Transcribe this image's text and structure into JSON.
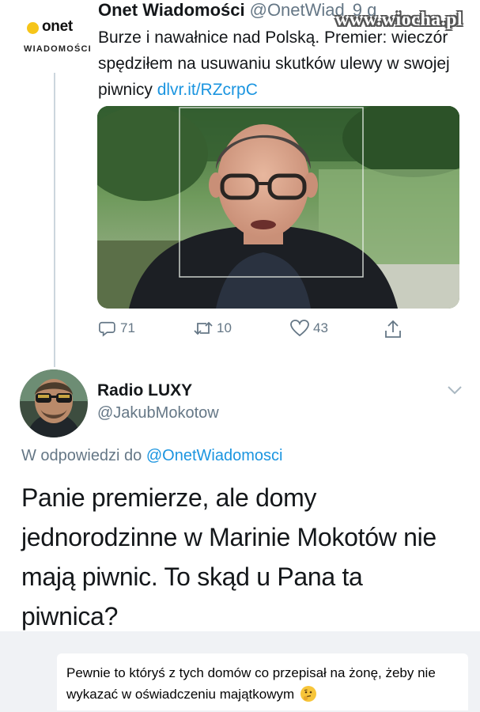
{
  "watermark": "www.wiocha.pl",
  "tweet": {
    "avatar": {
      "brand": "onet",
      "subtitle": "WIADOMOŚCI",
      "accent": "#f6c519"
    },
    "name": "Onet Wiadomości",
    "handle": "@OnetWiad",
    "time": "9 g",
    "text": "Burze i nawałnice nad Polską. Premier: wieczór spędziłem na usuwaniu skutków ulewy w swojej piwnicy ",
    "link": "dlvr.it/RZcrpC",
    "actions": {
      "replies": "71",
      "retweets": "10",
      "likes": "43"
    }
  },
  "reply": {
    "name": "Radio LUXY",
    "handle": "@JakubMokotow",
    "replying_prefix": "W odpowiedzi do ",
    "replying_to": "@OnetWiadomosci",
    "text": "Panie premierze, ale domy jednorodzinne w Marinie Mokotów nie mają piwnic. To skąd u Pana ta piwnica?"
  },
  "comment": {
    "text": "Pewnie to któryś z tych domów co przepisał na żonę, żeby nie wykazać w oświadczeniu majątkowym"
  },
  "colors": {
    "link": "#1b95e0",
    "secondary": "#657786",
    "primary": "#14171a",
    "emoji": "#f7c53a"
  }
}
